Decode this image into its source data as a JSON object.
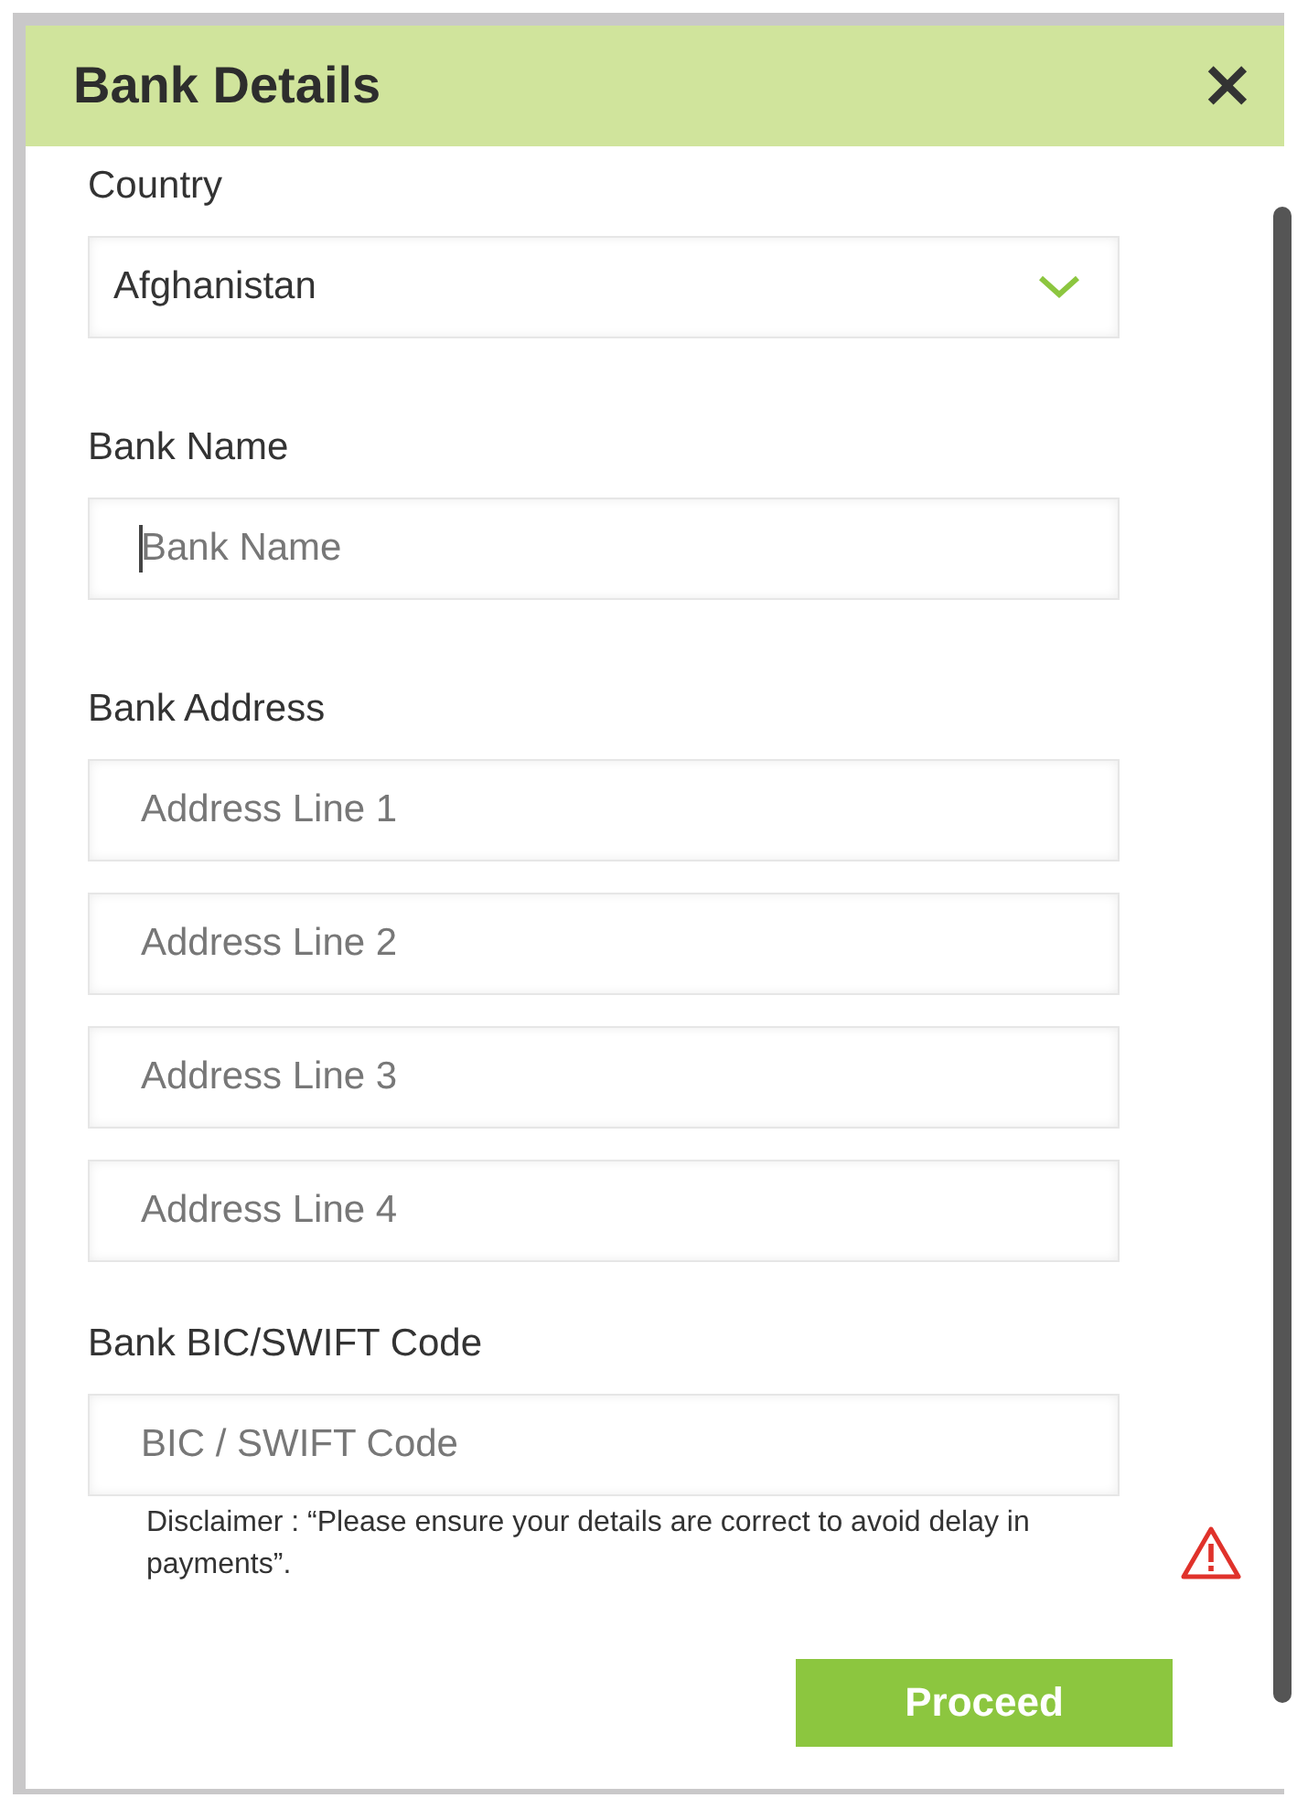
{
  "dialog": {
    "title": "Bank Details",
    "close": "×"
  },
  "sections": [
    {
      "label": "Country",
      "fields": [
        {
          "kind": "select",
          "value": "Afghanistan"
        }
      ]
    },
    {
      "label": "Bank Name",
      "fields": [
        {
          "kind": "input",
          "placeholder": "Bank Name",
          "focused": true
        }
      ]
    },
    {
      "label": "Bank Address",
      "fields": [
        {
          "kind": "input",
          "placeholder": "Address Line 1",
          "focused": false
        },
        {
          "kind": "input",
          "placeholder": "Address Line 2",
          "focused": false
        },
        {
          "kind": "input",
          "placeholder": "Address Line 3",
          "focused": false
        },
        {
          "kind": "input",
          "placeholder": "Address Line 4",
          "focused": false
        }
      ]
    },
    {
      "label": "Bank BIC/SWIFT Code",
      "fields": [
        {
          "kind": "input",
          "placeholder": "BIC / SWIFT Code",
          "focused": false
        }
      ]
    }
  ],
  "disclaimer": "Disclaimer : “Please ensure your details are correct to avoid delay in payments”.",
  "button": "Proceed"
}
